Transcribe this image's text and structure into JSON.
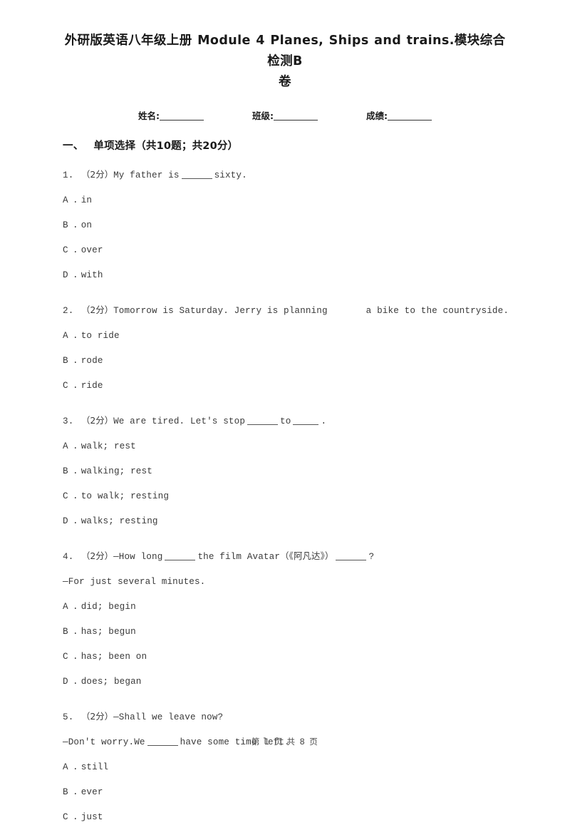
{
  "document": {
    "title_line1": "外研版英语八年级上册 Module 4 Planes, Ships and trains.模块综合检测B",
    "title_line2": "卷"
  },
  "identity": {
    "name_label": "姓名:",
    "class_label": "班级:",
    "score_label": "成绩:"
  },
  "section": {
    "index": "一、",
    "title": "单项选择（共10题；共20分）"
  },
  "questions": [
    {
      "number": "1.",
      "score": "（2分）",
      "stem_before": "My father is",
      "stem_after": "sixty.",
      "options": [
        {
          "letter": "A",
          "dot": ".",
          "text": "in"
        },
        {
          "letter": "B",
          "dot": ".",
          "text": "on"
        },
        {
          "letter": "C",
          "dot": ".",
          "text": "over"
        },
        {
          "letter": "D",
          "dot": ".",
          "text": "with"
        }
      ]
    },
    {
      "number": "2.",
      "score": "（2分）",
      "stem_before": "Tomorrow is Saturday. Jerry is planning",
      "stem_after": "a bike to the countryside.",
      "options": [
        {
          "letter": "A",
          "dot": ".",
          "text": "to ride"
        },
        {
          "letter": "B",
          "dot": ".",
          "text": "rode"
        },
        {
          "letter": "C",
          "dot": ".",
          "text": "ride"
        }
      ]
    },
    {
      "number": "3.",
      "score": "（2分）",
      "stem_before": "We are tired. Let's stop",
      "stem_middle": "to",
      "stem_after": ".",
      "options": [
        {
          "letter": "A",
          "dot": ".",
          "text": "walk; rest"
        },
        {
          "letter": "B",
          "dot": ".",
          "text": "walking; rest"
        },
        {
          "letter": "C",
          "dot": ".",
          "text": "to walk; resting"
        },
        {
          "letter": "D",
          "dot": ".",
          "text": "walks; resting"
        }
      ]
    },
    {
      "number": "4.",
      "score": "（2分）",
      "stem_before": "—How long",
      "stem_middle": "the film Avatar",
      "stem_cn": "（《阿凡达》）",
      "stem_after": "?",
      "extra_line": "—For just several minutes.",
      "options": [
        {
          "letter": "A",
          "dot": ".",
          "text": "did; begin"
        },
        {
          "letter": "B",
          "dot": ".",
          "text": "has; begun"
        },
        {
          "letter": "C",
          "dot": ".",
          "text": "has; been on"
        },
        {
          "letter": "D",
          "dot": ".",
          "text": "does; began"
        }
      ]
    },
    {
      "number": "5.",
      "score": "（2分）",
      "stem_before": "—Shall we leave now?",
      "extra_before": "—Don't worry.We",
      "extra_after": "have some time left.",
      "options": [
        {
          "letter": "A",
          "dot": ".",
          "text": "still"
        },
        {
          "letter": "B",
          "dot": ".",
          "text": "ever"
        },
        {
          "letter": "C",
          "dot": ".",
          "text": "just"
        }
      ]
    }
  ],
  "footer": {
    "text": "第 1 页 共 8 页"
  }
}
